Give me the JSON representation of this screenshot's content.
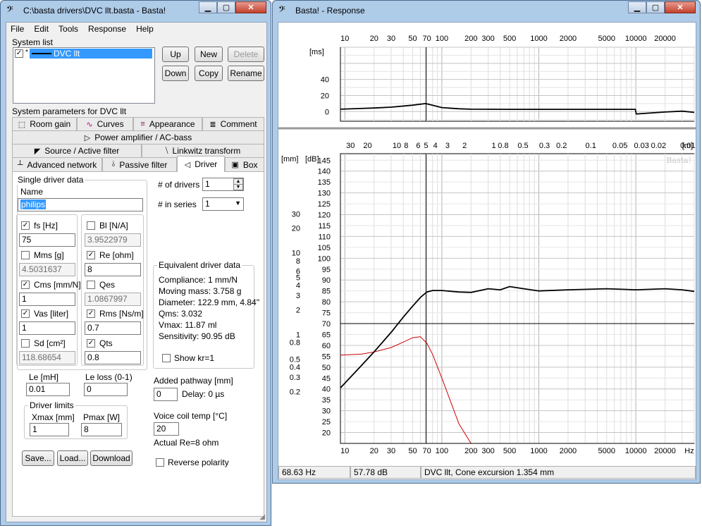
{
  "main_window": {
    "title": "C:\\basta drivers\\DVC llt.basta - Basta!",
    "menu": [
      "File",
      "Edit",
      "Tools",
      "Response",
      "Help"
    ],
    "system_list": {
      "label": "System list",
      "items": [
        {
          "checked": true,
          "marker": "*",
          "name": "DVC llt",
          "selected": true
        }
      ]
    },
    "list_buttons": {
      "up": "Up",
      "new": "New",
      "delete": "Delete",
      "down": "Down",
      "copy": "Copy",
      "rename": "Rename"
    },
    "params_label": "System parameters for DVC llt",
    "tabs_row1": [
      {
        "icon": "⬚",
        "label": "Room gain"
      },
      {
        "icon": "∿",
        "label": "Curves"
      },
      {
        "icon": "≡",
        "label": "Appearance"
      },
      {
        "icon": "≣",
        "label": "Comment"
      }
    ],
    "tabs_row2": [
      {
        "icon": "▷",
        "label": "Power amplifier / AC-bass"
      }
    ],
    "tabs_row3": [
      {
        "icon": "◤",
        "label": "Source / Active filter"
      },
      {
        "icon": "⧹",
        "label": "Linkwitz transform"
      }
    ],
    "tabs_row4": [
      {
        "icon": "┴",
        "label": "Advanced network"
      },
      {
        "icon": "⫰",
        "label": "Passive filter"
      },
      {
        "icon": "◁",
        "label": "Driver"
      },
      {
        "icon": "▣",
        "label": "Box"
      }
    ],
    "driver": {
      "group_label": "Single driver data",
      "name_label": "Name",
      "name_value": "philips",
      "params": [
        {
          "label": "fs [Hz]",
          "checked": true,
          "value": "75",
          "ro": false
        },
        {
          "label": "Bl [N/A]",
          "checked": false,
          "value": "3.9522979",
          "ro": true
        },
        {
          "label": "Mms [g]",
          "checked": false,
          "value": "4.5031637",
          "ro": true
        },
        {
          "label": "Re [ohm]",
          "checked": true,
          "value": "8",
          "ro": false
        },
        {
          "label": "Cms [mm/N]",
          "checked": true,
          "value": "1",
          "ro": false
        },
        {
          "label": "Qes",
          "checked": false,
          "value": "1.0867997",
          "ro": true
        },
        {
          "label": "Vas [liter]",
          "checked": true,
          "value": "1",
          "ro": false
        },
        {
          "label": "Rms [Ns/m]",
          "checked": true,
          "value": "0.7",
          "ro": false
        },
        {
          "label": "Sd [cm²]",
          "checked": false,
          "value": "118.68654",
          "ro": true
        },
        {
          "label": "Qts",
          "checked": true,
          "value": "0.8",
          "ro": false
        }
      ],
      "le_label": "Le [mH]",
      "le_value": "0.01",
      "leloss_label": "Le loss (0-1)",
      "leloss_value": "0",
      "limits_label": "Driver limits",
      "xmax_label": "Xmax [mm]",
      "xmax_value": "1",
      "pmax_label": "Pmax [W]",
      "pmax_value": "8",
      "save": "Save...",
      "load": "Load...",
      "download": "Download",
      "num_drivers_label": "# of drivers",
      "num_drivers_value": "1",
      "in_series_label": "# in series",
      "in_series_value": "1",
      "equiv": {
        "label": "Equivalent driver data",
        "lines": [
          "Compliance: 1 mm/N",
          "Moving mass: 3.758 g",
          "Diameter: 122.9 mm, 4.84''",
          "Qms: 3.032",
          "Vmax: 11.87 ml",
          "Sensitivity: 90.95 dB"
        ],
        "show_kr": "Show kr=1"
      },
      "pathway_label": "Added pathway [mm]",
      "pathway_value": "0",
      "delay_text": "Delay: 0 µs",
      "vc_temp_label": "Voice coil temp [°C]",
      "vc_temp_value": "20",
      "actual_re": "Actual Re=8 ohm",
      "reverse": "Reverse polarity"
    }
  },
  "response_window": {
    "title": "Basta! - Response",
    "status": {
      "freq": "68.63 Hz",
      "level": "57.78 dB",
      "info": "DVC llt, Cone excursion 1.354 mm"
    },
    "watermark": "Basta!"
  },
  "chart_data": [
    {
      "type": "line",
      "title": "",
      "x_scale": "log",
      "xlim": [
        9,
        40000
      ],
      "x_ticks": [
        "10",
        "20",
        "30",
        "50",
        "70",
        "100",
        "200",
        "300",
        "500",
        "1000",
        "2000",
        "5000",
        "10000",
        "20000"
      ],
      "ylabel": "[ms]",
      "ylim": [
        -12,
        80
      ],
      "y_ticks": [
        "40",
        "20",
        "0"
      ],
      "cursor_x": 68.63,
      "series": [
        {
          "name": "",
          "color": "#000000",
          "x": [
            9,
            20,
            30,
            50,
            68,
            80,
            100,
            150,
            200,
            500,
            1000,
            5000,
            9900,
            10100,
            20000,
            30000,
            40000
          ],
          "y": [
            3.0,
            4.5,
            5.5,
            8.0,
            10.0,
            8.0,
            5.0,
            3.5,
            3.0,
            2.8,
            2.8,
            2.8,
            2.8,
            -3.0,
            -0.5,
            0.5,
            -1.0
          ]
        }
      ]
    },
    {
      "type": "line",
      "title": "",
      "x_scale": "log",
      "xlim": [
        9,
        40000
      ],
      "x_ticks": [
        "10",
        "20",
        "30",
        "50",
        "70",
        "100",
        "200",
        "300",
        "500",
        "1000",
        "2000",
        "5000",
        "10000",
        "20000",
        "Hz"
      ],
      "top_axis_label": "[m]",
      "top_ticks": [
        "30",
        "20",
        "10",
        "8",
        "6",
        "5",
        "4",
        "3",
        "2",
        "1",
        "0.8",
        "0.5",
        "0.3",
        "0.2",
        "0.1",
        "0.05",
        "0.03",
        "0.02",
        "0.01"
      ],
      "ylabel": "[dB]",
      "ylim": [
        15,
        148
      ],
      "y_ticks": [
        "145",
        "140",
        "135",
        "130",
        "125",
        "120",
        "115",
        "110",
        "105",
        "100",
        "95",
        "90",
        "85",
        "80",
        "75",
        "70",
        "65",
        "60",
        "55",
        "50",
        "45",
        "40",
        "35",
        "30",
        "25",
        "20"
      ],
      "y2label": "[mm]",
      "y2_ticks": [
        "30",
        "20",
        "10",
        "8",
        "6",
        "5",
        "4",
        "3",
        "2",
        "1",
        "0.8",
        "0.5",
        "0.4",
        "0.3",
        "0.2"
      ],
      "cursor_x": 68.63,
      "ref_level_db": 70,
      "series": [
        {
          "name": "",
          "color": "#000000",
          "x": [
            9,
            15,
            20,
            30,
            40,
            50,
            60,
            70,
            80,
            100,
            150,
            200,
            300,
            400,
            500,
            700,
            1000,
            2000,
            5000,
            10000,
            20000,
            30000,
            40000
          ],
          "y": [
            40.5,
            51,
            57,
            66,
            73,
            78,
            82,
            84.5,
            85.2,
            85.2,
            84.5,
            84.3,
            86,
            85.5,
            87,
            86,
            85,
            85.5,
            86,
            85.5,
            86,
            85.5,
            84.8
          ]
        },
        {
          "name": "",
          "color": "#cc0000",
          "x": [
            9,
            15,
            20,
            30,
            40,
            50,
            60,
            70,
            80,
            100,
            150,
            200,
            500,
            1000,
            5000,
            10000,
            20000,
            40000
          ],
          "y": [
            55.5,
            56,
            57,
            59,
            61.5,
            63.5,
            64,
            61,
            56,
            45,
            24,
            15,
            15,
            15,
            15,
            15,
            15,
            15
          ]
        }
      ]
    }
  ]
}
